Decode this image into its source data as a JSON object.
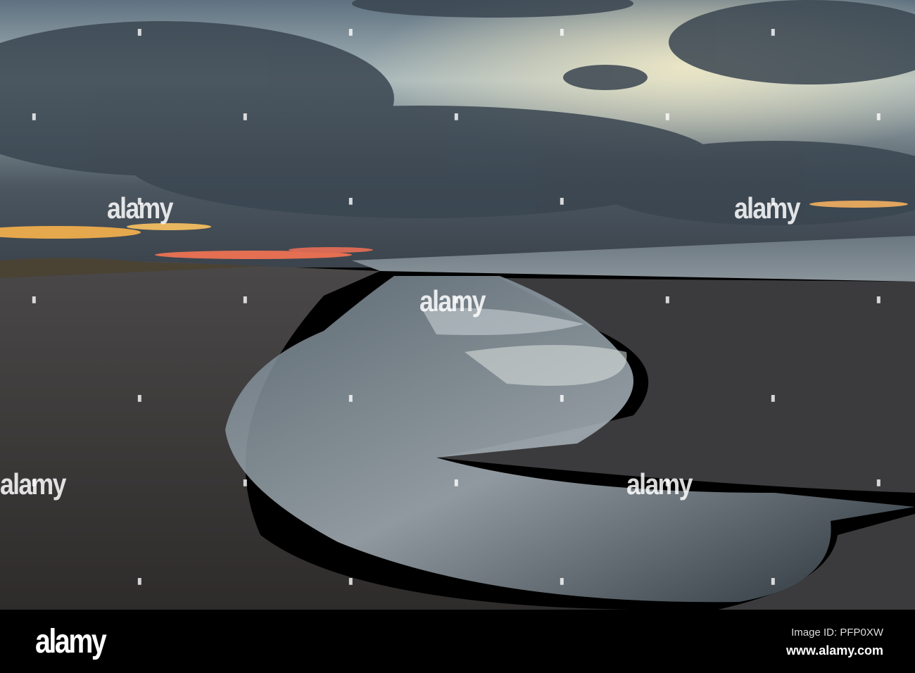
{
  "photo": {
    "subject": "beach-tidal-pool-at-dusk"
  },
  "watermark": {
    "text": "alamy"
  },
  "footer": {
    "logo": "alamy",
    "image_id": "Image ID: PFP0XW",
    "website": "www.alamy.com"
  }
}
